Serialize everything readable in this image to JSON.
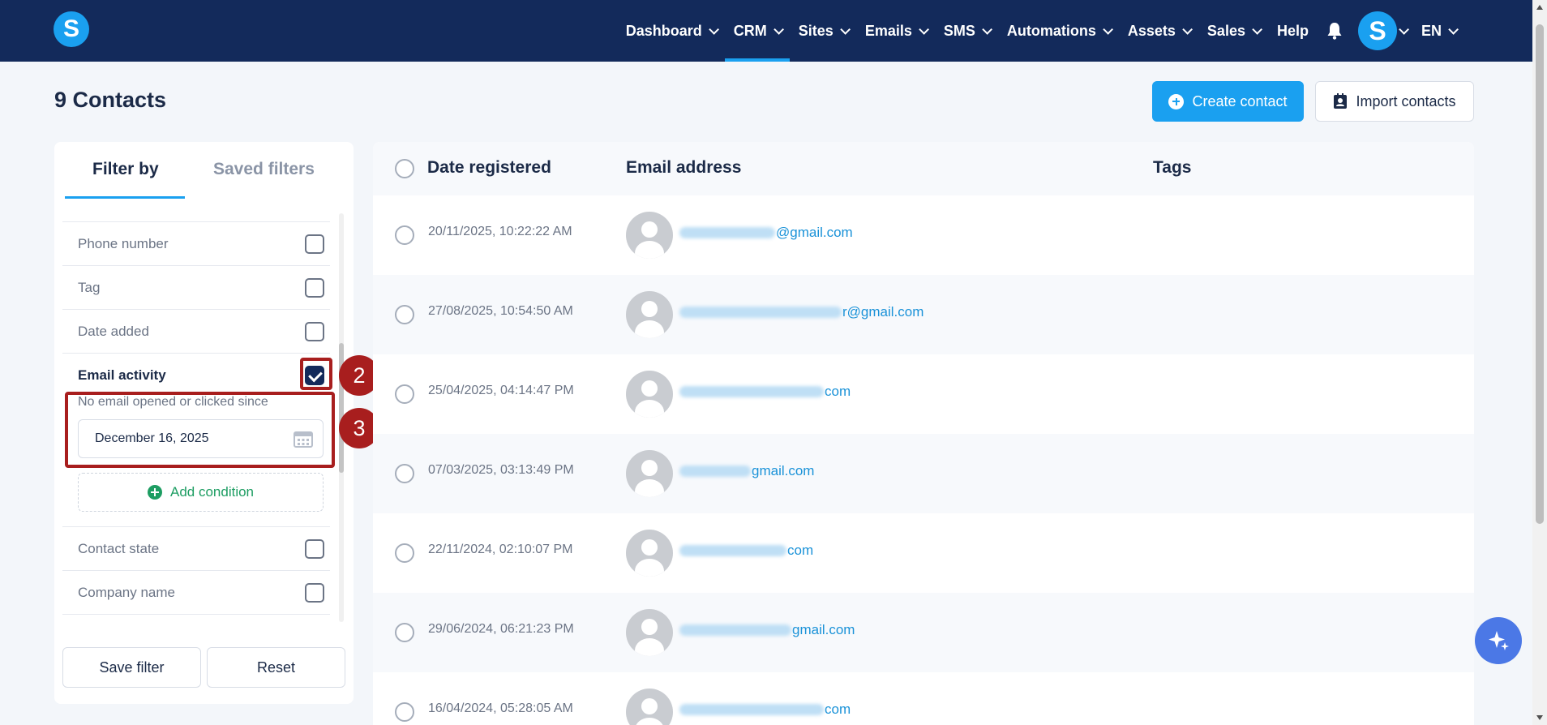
{
  "nav": {
    "items": [
      {
        "label": "Dashboard",
        "chevron": true,
        "active": false
      },
      {
        "label": "CRM",
        "chevron": true,
        "active": true
      },
      {
        "label": "Sites",
        "chevron": true,
        "active": false
      },
      {
        "label": "Emails",
        "chevron": true,
        "active": false
      },
      {
        "label": "SMS",
        "chevron": true,
        "active": false
      },
      {
        "label": "Automations",
        "chevron": true,
        "active": false
      },
      {
        "label": "Assets",
        "chevron": true,
        "active": false
      },
      {
        "label": "Sales",
        "chevron": true,
        "active": false
      },
      {
        "label": "Help",
        "chevron": false,
        "active": false
      }
    ],
    "logo_letter": "S",
    "avatar_letter": "S",
    "language": "EN",
    "accent": "#1aa0f0",
    "bar_color": "#132a5b"
  },
  "header": {
    "title": "9 Contacts",
    "create_label": "Create contact",
    "import_label": "Import contacts"
  },
  "filter": {
    "tab_filter": "Filter by",
    "tab_saved": "Saved filters",
    "rows": [
      {
        "label": "Phone number",
        "checked": false
      },
      {
        "label": "Tag",
        "checked": false
      },
      {
        "label": "Date added",
        "checked": false
      },
      {
        "label": "Email activity",
        "checked": true
      },
      {
        "label": "Contact state",
        "checked": false
      },
      {
        "label": "Company name",
        "checked": false
      }
    ],
    "condition_label": "No email opened or clicked since",
    "date_value": "December 16, 2025",
    "add_condition": "Add condition",
    "save_label": "Save filter",
    "reset_label": "Reset"
  },
  "annotations": {
    "checkbox_badge": "2",
    "date_badge": "3",
    "color": "#a81e1e"
  },
  "table": {
    "columns": [
      "Date registered",
      "Email address",
      "Tags"
    ],
    "rows": [
      {
        "date": "20/11/2025, 10:22:22 AM",
        "email_suffix": "@gmail.com"
      },
      {
        "date": "27/08/2025, 10:54:50 AM",
        "email_suffix": "r@gmail.com"
      },
      {
        "date": "25/04/2025, 04:14:47 PM",
        "email_suffix": "com"
      },
      {
        "date": "07/03/2025, 03:13:49 PM",
        "email_suffix": "gmail.com"
      },
      {
        "date": "22/11/2024, 02:10:07 PM",
        "email_suffix": "com"
      },
      {
        "date": "29/06/2024, 06:21:23 PM",
        "email_suffix": "gmail.com"
      },
      {
        "date": "16/04/2024, 05:28:05 AM",
        "email_suffix": "com"
      }
    ]
  }
}
